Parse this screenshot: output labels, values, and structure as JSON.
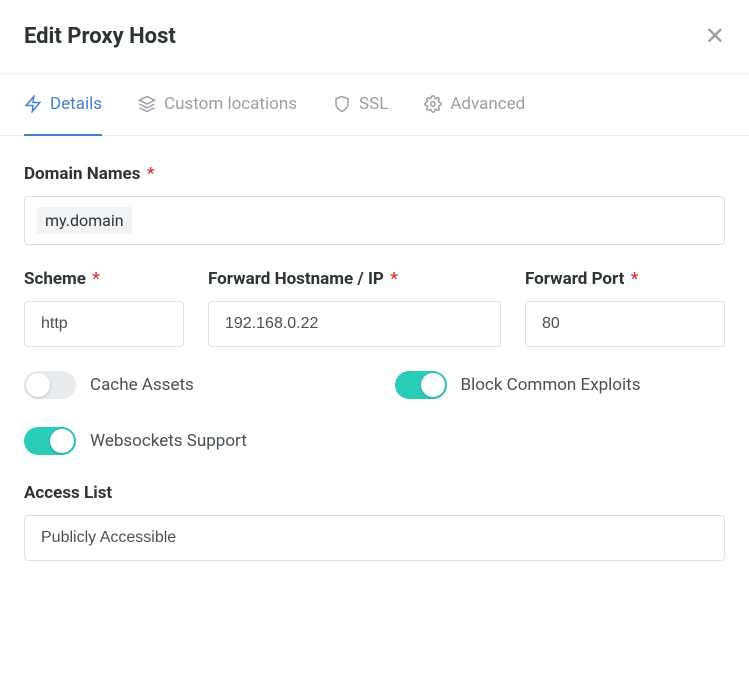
{
  "header": {
    "title": "Edit Proxy Host"
  },
  "tabs": {
    "details": "Details",
    "custom_locations": "Custom locations",
    "ssl": "SSL",
    "advanced": "Advanced"
  },
  "form": {
    "domain_names": {
      "label": "Domain Names",
      "value": "my.domain"
    },
    "scheme": {
      "label": "Scheme",
      "value": "http"
    },
    "forward_hostname": {
      "label": "Forward Hostname / IP",
      "value": "192.168.0.22"
    },
    "forward_port": {
      "label": "Forward Port",
      "value": "80"
    },
    "cache_assets": {
      "label": "Cache Assets",
      "enabled": false
    },
    "block_exploits": {
      "label": "Block Common Exploits",
      "enabled": true
    },
    "websockets": {
      "label": "Websockets Support",
      "enabled": true
    },
    "access_list": {
      "label": "Access List",
      "value": "Publicly Accessible"
    }
  }
}
